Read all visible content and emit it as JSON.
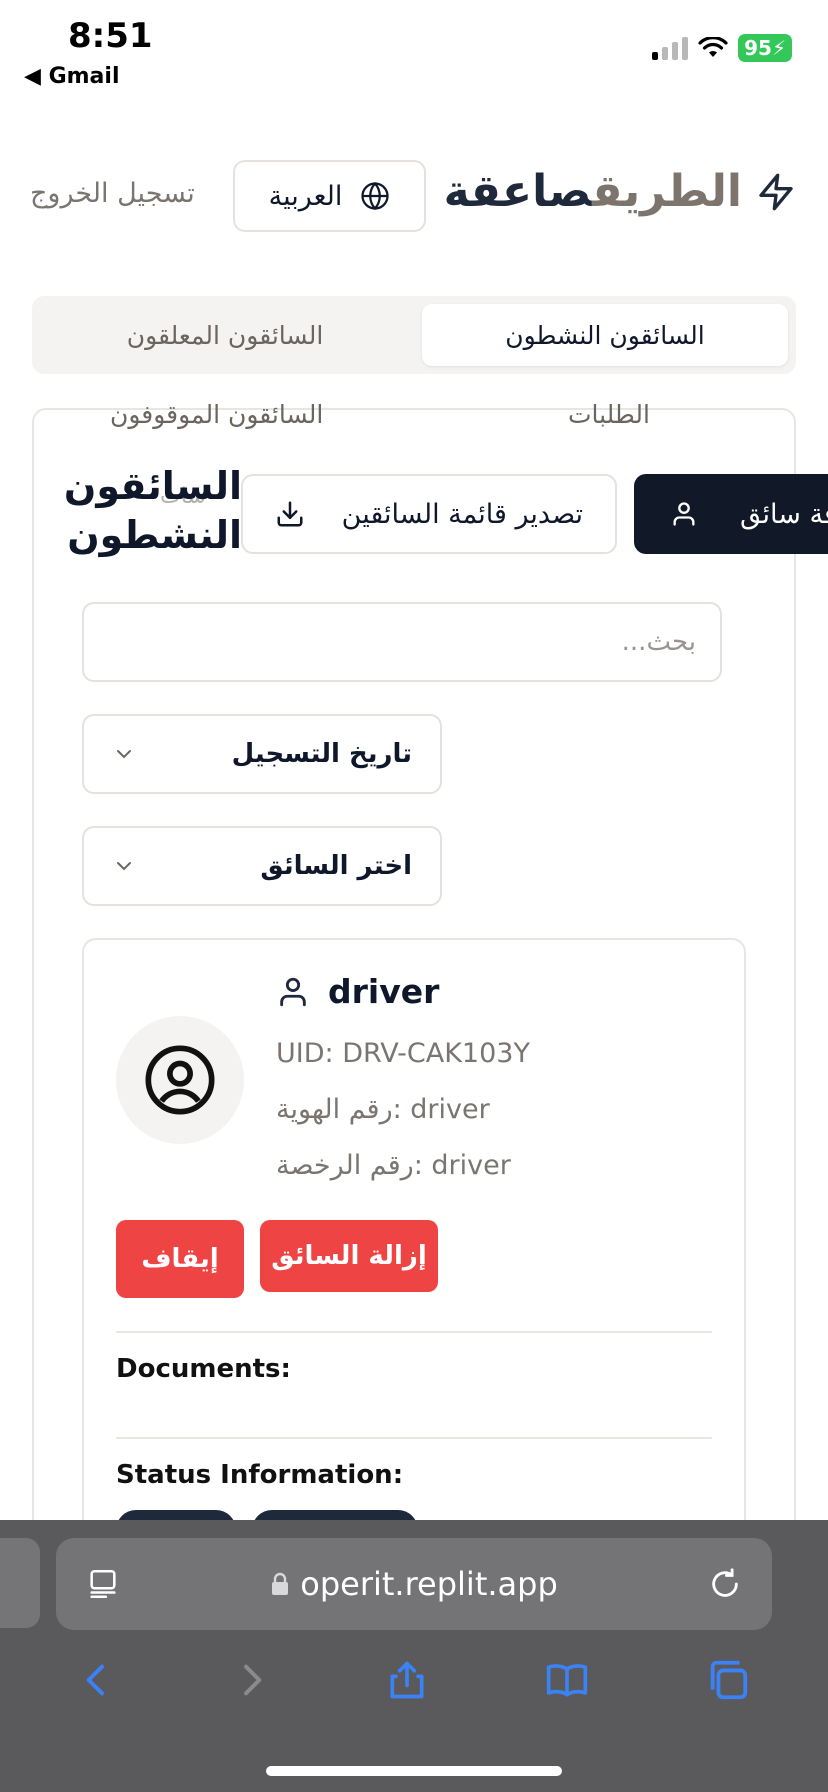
{
  "status_bar": {
    "time": "8:51",
    "back_app": "◀ Gmail",
    "battery": "95"
  },
  "header": {
    "brand_part1": "صاعقة",
    "brand_part2": "الطريق",
    "language": "العربية",
    "logout": "تسجيل الخروج"
  },
  "tabs": {
    "active": "السائقون النشطون",
    "suspended": "السائقون المعلقون"
  },
  "sub_tabs": {
    "requests": "الطلبات",
    "stopped": "السائقون الموقوفون",
    "ghost": "سات"
  },
  "page": {
    "title": "السائقون النشطون",
    "export_label": "تصدير قائمة السائقين",
    "add_label": "افة سائق",
    "search_placeholder": "بحث..."
  },
  "filters": {
    "registration_date": "تاريخ التسجيل",
    "choose_driver": "اختر السائق"
  },
  "driver": {
    "name": "driver",
    "uid": "UID: DRV-CAK103Y",
    "id_number": "رقم الهوية: driver",
    "license_number": "رقم الرخصة: driver",
    "stop_label": "إيقاف",
    "remove_label": "إزالة السائق",
    "documents_label": "Documents:",
    "status_label": "Status Information:"
  },
  "browser": {
    "url": "operit.replit.app"
  },
  "colors": {
    "accent_dark": "#111827",
    "danger": "#ef4444",
    "brand_muted": "#7d756d"
  }
}
